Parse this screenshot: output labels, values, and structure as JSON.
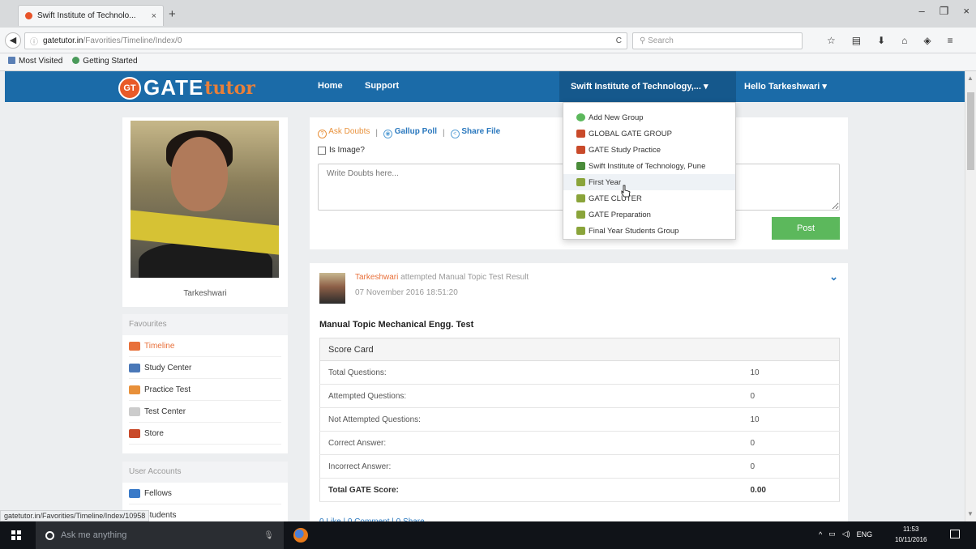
{
  "browser": {
    "tab_title": "Swift Institute of Technolo...",
    "tab_close": "×",
    "new_tab": "+",
    "window_controls": [
      "–",
      "❐",
      "×"
    ],
    "url_host": "gatetutor.in",
    "url_path": "/Favorities/Timeline/Index/0",
    "search_placeholder": "Search",
    "bookmarks": [
      "Most Visited",
      "Getting Started"
    ],
    "status_url": "gatetutor.in/Favorities/Timeline/Index/10958"
  },
  "site": {
    "logo_badge": "GT",
    "logo_gate": "GATE",
    "logo_tutor": "tutor",
    "nav": {
      "home": "Home",
      "support": "Support",
      "institute": "Swift Institute of Technology,... ▾",
      "user": "Hello Tarkeshwari ▾"
    }
  },
  "dropdown": {
    "items": [
      {
        "label": "Add New Group",
        "icon": "add-group-icon"
      },
      {
        "label": "GLOBAL GATE GROUP",
        "icon": "group-icon"
      },
      {
        "label": "GATE Study Practice",
        "icon": "group-icon"
      },
      {
        "label": "Swift Institute of Technology, Pune",
        "icon": "institute-icon"
      },
      {
        "label": "First Year",
        "icon": "subgroup-icon"
      },
      {
        "label": "GATE CLUTER",
        "icon": "subgroup-icon"
      },
      {
        "label": "GATE Preparation",
        "icon": "subgroup-icon"
      },
      {
        "label": "Final Year Students Group",
        "icon": "subgroup-icon"
      }
    ]
  },
  "profile": {
    "name": "Tarkeshwari"
  },
  "sidebar": {
    "favourites_title": "Favourites",
    "favourites": [
      {
        "label": "Timeline",
        "color": "#e8703a"
      },
      {
        "label": "Study Center",
        "color": "#4a78b8"
      },
      {
        "label": "Practice Test",
        "color": "#e8903a"
      },
      {
        "label": "Test Center",
        "color": "#aaaaaa"
      },
      {
        "label": "Store",
        "color": "#c94a2a"
      }
    ],
    "accounts_title": "User Accounts",
    "accounts": [
      {
        "label": "Fellows",
        "color": "#3a7ac8"
      },
      {
        "label": "Students",
        "color": "#3a7ac8"
      }
    ]
  },
  "post": {
    "ask_doubts": "Ask Doubts",
    "gallup_poll": "Gallup Poll",
    "share_file": "Share File",
    "separator": "|",
    "is_image": "Is Image?",
    "placeholder": "Write Doubts here...",
    "post_button": "Post"
  },
  "feed": {
    "author": "Tarkeshwari",
    "action": "attempted Manual Topic Test Result",
    "date": "07 November 2016 18:51:20",
    "test_title": "Manual Topic Mechanical Engg. Test",
    "score_card_title": "Score Card",
    "rows": [
      {
        "label": "Total Questions:",
        "value": "10"
      },
      {
        "label": "Attempted Questions:",
        "value": "0"
      },
      {
        "label": "Not Attempted Questions:",
        "value": "10"
      },
      {
        "label": "Correct Answer:",
        "value": "0"
      },
      {
        "label": "Incorrect Answer:",
        "value": "0"
      }
    ],
    "total_label": "Total GATE Score:",
    "total_value": "0.00",
    "actions": "0 Like | 0 Comment | 0 Share"
  },
  "taskbar": {
    "search_placeholder": "Ask me anything",
    "lang": "ENG",
    "time": "11:53",
    "date": "10/11/2016"
  }
}
